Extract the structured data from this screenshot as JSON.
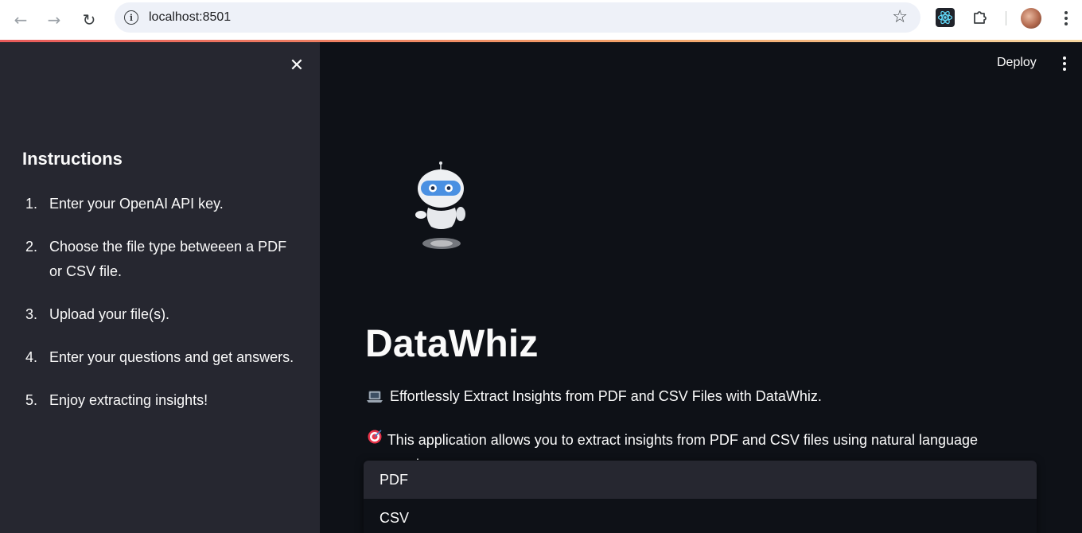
{
  "browser": {
    "url": "localhost:8501",
    "back_icon": "back-arrow-icon",
    "forward_icon": "forward-arrow-icon",
    "reload_icon": "reload-icon"
  },
  "sidebar": {
    "title": "Instructions",
    "items": [
      {
        "num": "1.",
        "text": "Enter your OpenAI API key."
      },
      {
        "num": "2.",
        "text": "Choose the file type betweeen a PDF or CSV file."
      },
      {
        "num": "3.",
        "text": "Upload your file(s)."
      },
      {
        "num": "4.",
        "text": "Enter your questions and get answers."
      },
      {
        "num": "5.",
        "text": "Enjoy extracting insights!"
      }
    ]
  },
  "header": {
    "deploy_label": "Deploy"
  },
  "main": {
    "title": "DataWhiz",
    "line1": "Effortlessly Extract Insights from PDF and CSV Files with DataWhiz.",
    "line2": "This application allows you to extract insights from PDF and CSV files using natural language processing."
  },
  "dropdown": {
    "options": [
      "PDF",
      "CSV"
    ],
    "highlighted": "PDF"
  },
  "colors": {
    "sidebar_bg": "#262730",
    "main_bg": "#0e1117",
    "text": "#fafafa"
  }
}
